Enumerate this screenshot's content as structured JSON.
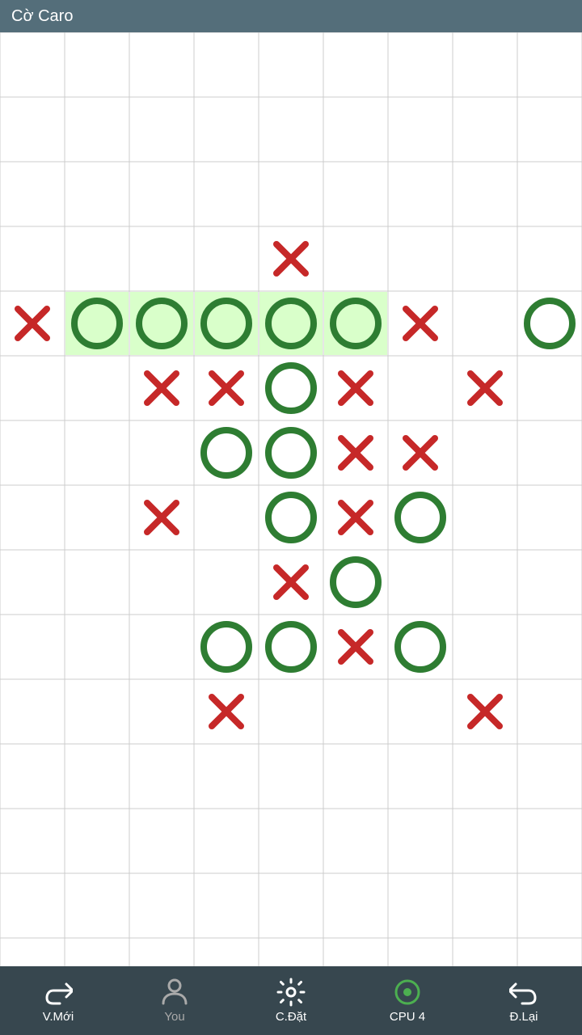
{
  "titleBar": {
    "title": "Cờ Caro"
  },
  "board": {
    "cols": 9,
    "rows": 14,
    "cellSize": 80,
    "offsetX": 0,
    "offsetY": 0
  },
  "pieces": [
    {
      "type": "X",
      "row": 4,
      "col": 0
    },
    {
      "type": "O",
      "row": 4,
      "col": 1,
      "highlight": true
    },
    {
      "type": "O",
      "row": 4,
      "col": 2,
      "highlight": true
    },
    {
      "type": "O",
      "row": 4,
      "col": 3,
      "highlight": true
    },
    {
      "type": "O",
      "row": 4,
      "col": 4,
      "highlight": true
    },
    {
      "type": "O",
      "row": 4,
      "col": 5,
      "highlight": true
    },
    {
      "type": "X",
      "row": 4,
      "col": 6
    },
    {
      "type": "O",
      "row": 4,
      "col": 8
    },
    {
      "type": "X",
      "row": 3,
      "col": 4
    },
    {
      "type": "X",
      "row": 5,
      "col": 2
    },
    {
      "type": "X",
      "row": 5,
      "col": 3
    },
    {
      "type": "O",
      "row": 5,
      "col": 4
    },
    {
      "type": "X",
      "row": 5,
      "col": 5
    },
    {
      "type": "X",
      "row": 5,
      "col": 7
    },
    {
      "type": "O",
      "row": 6,
      "col": 3
    },
    {
      "type": "O",
      "row": 6,
      "col": 4
    },
    {
      "type": "X",
      "row": 6,
      "col": 5
    },
    {
      "type": "X",
      "row": 6,
      "col": 6
    },
    {
      "type": "X",
      "row": 7,
      "col": 2
    },
    {
      "type": "O",
      "row": 7,
      "col": 4
    },
    {
      "type": "X",
      "row": 7,
      "col": 5
    },
    {
      "type": "O",
      "row": 7,
      "col": 6
    },
    {
      "type": "X",
      "row": 8,
      "col": 4
    },
    {
      "type": "O",
      "row": 8,
      "col": 5
    },
    {
      "type": "O",
      "row": 9,
      "col": 3
    },
    {
      "type": "O",
      "row": 9,
      "col": 4
    },
    {
      "type": "X",
      "row": 9,
      "col": 5
    },
    {
      "type": "O",
      "row": 9,
      "col": 6
    },
    {
      "type": "X",
      "row": 10,
      "col": 3
    },
    {
      "type": "X",
      "row": 10,
      "col": 7
    }
  ],
  "bottomBar": {
    "buttons": [
      {
        "id": "new-game",
        "label": "V.Mới",
        "icon": "redo"
      },
      {
        "id": "you",
        "label": "You",
        "icon": "person",
        "active": true
      },
      {
        "id": "settings",
        "label": "C.Đặt",
        "icon": "gear"
      },
      {
        "id": "cpu",
        "label": "CPU 4",
        "icon": "circle-outline"
      },
      {
        "id": "undo",
        "label": "Đ.Lại",
        "icon": "undo"
      }
    ]
  }
}
